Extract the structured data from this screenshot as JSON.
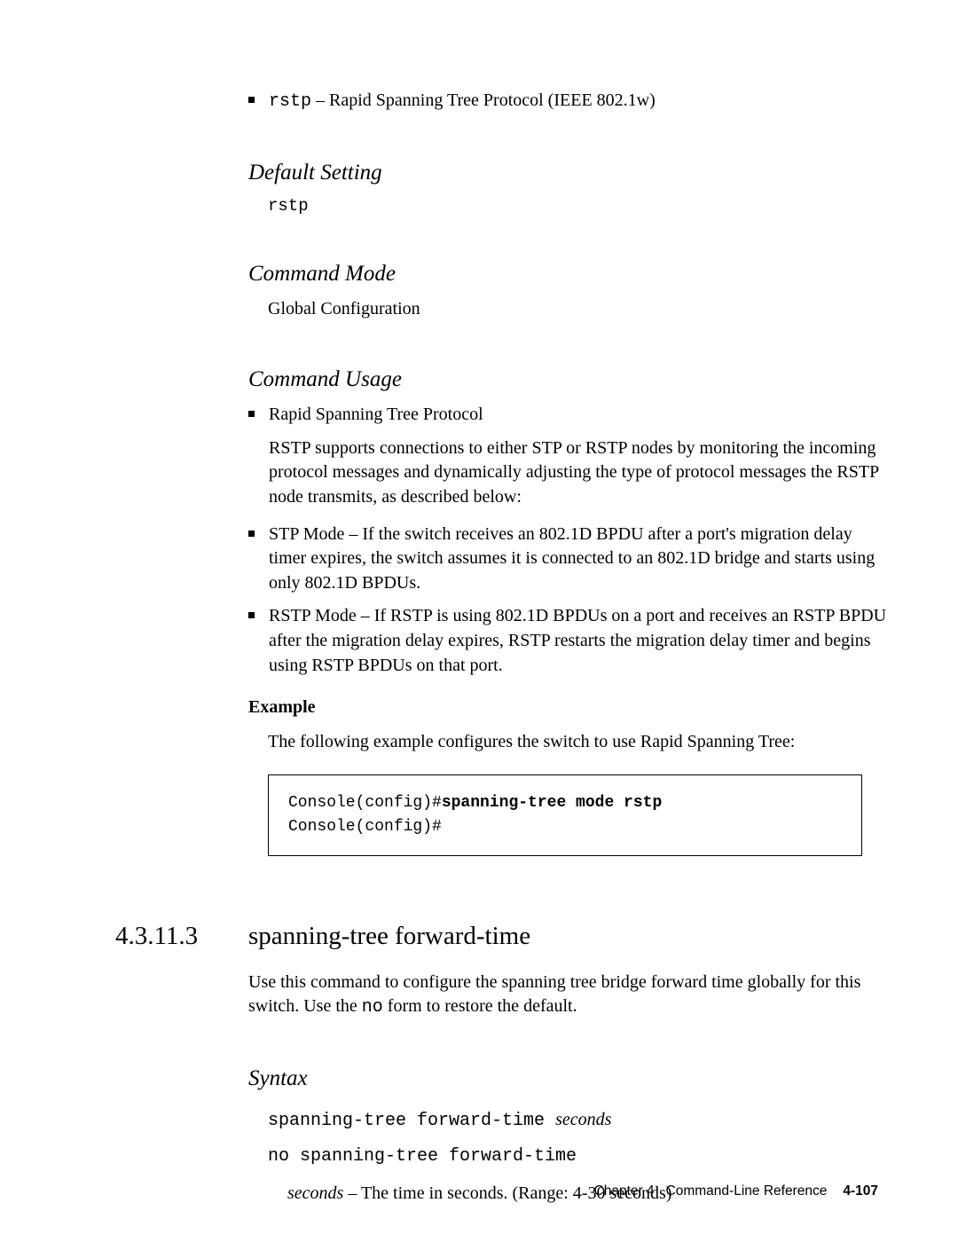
{
  "top_bullet": {
    "code": "rstp",
    "desc": " – Rapid Spanning Tree Protocol (IEEE 802.1w)"
  },
  "default_setting": {
    "heading": "Default Setting",
    "value": "rstp"
  },
  "command_mode": {
    "heading": "Command Mode",
    "value": "Global Configuration"
  },
  "command_usage": {
    "heading": "Command Usage",
    "bullets": [
      {
        "lead": "Rapid Spanning Tree Protocol",
        "sub": "RSTP supports connections to either STP or RSTP nodes by monitoring the incoming protocol messages and dynamically adjusting the type of protocol messages the RSTP node transmits, as described below:"
      },
      {
        "lead": "STP Mode – If the switch receives an 802.1D BPDU after a port's migration delay timer expires, the switch assumes it is connected to an 802.1D bridge and starts using only 802.1D BPDUs."
      },
      {
        "lead": "RSTP Mode – If RSTP is using 802.1D BPDUs on a port and receives an RSTP BPDU after the migration delay expires, RSTP restarts the migration delay timer and begins using RSTP BPDUs on that port."
      }
    ]
  },
  "example": {
    "label": "Example",
    "intro": "The following example configures the switch to use Rapid Spanning Tree:",
    "code_prompt1": "Console(config)#",
    "code_cmd": "spanning-tree mode rstp",
    "code_prompt2": "Console(config)#"
  },
  "chapter": {
    "number": "4.3.11.3",
    "title": "spanning-tree forward-time",
    "intro_a": "Use this command to configure the spanning tree bridge forward time globally for this switch. Use the ",
    "intro_code": "no",
    "intro_b": " form to restore the default."
  },
  "syntax": {
    "heading": "Syntax",
    "line1_code": "spanning-tree forward-time ",
    "line1_arg": "seconds",
    "line2_code": "no spanning-tree forward-time",
    "desc_arg": "seconds",
    "desc_text": " – The time in seconds. (Range: 4-30 seconds)"
  },
  "footer": {
    "chapter": "Chapter 4",
    "title": "Command-Line Reference",
    "page": "4-107"
  }
}
